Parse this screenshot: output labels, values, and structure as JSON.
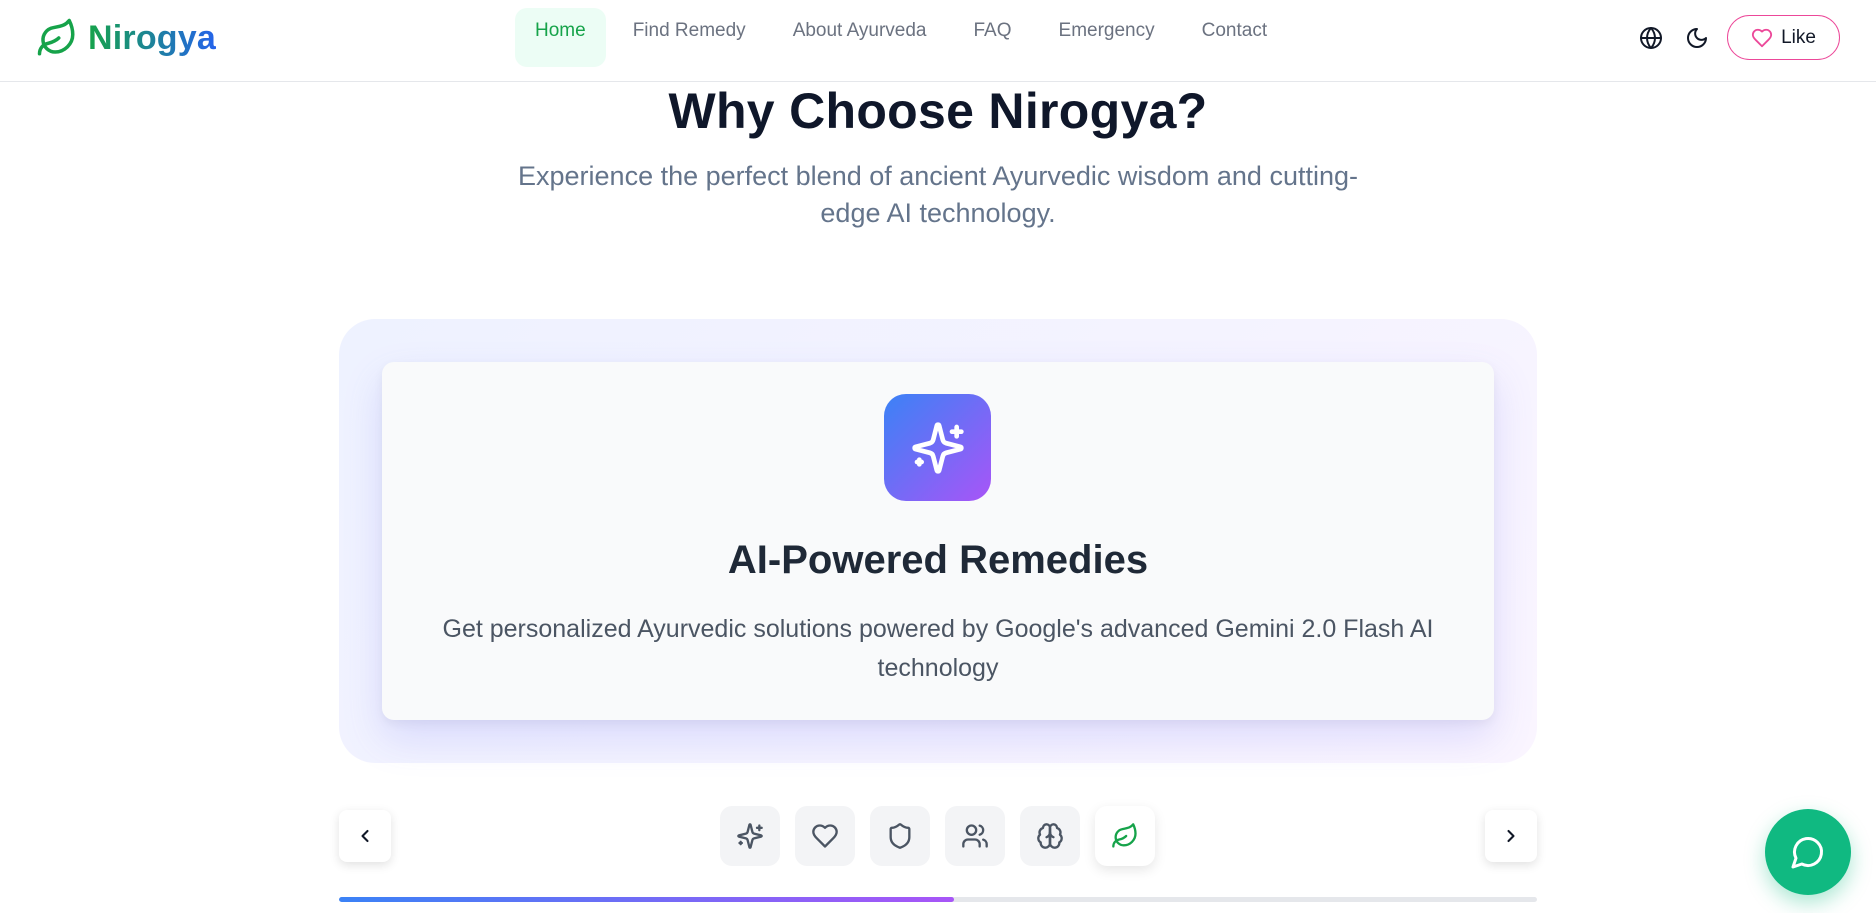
{
  "brand": {
    "name": "Nirogya",
    "icon": "leaf-icon"
  },
  "nav": {
    "items": [
      {
        "label": "Home",
        "active": true
      },
      {
        "label": "Find Remedy",
        "active": false
      },
      {
        "label": "About Ayurveda",
        "active": false
      },
      {
        "label": "FAQ",
        "active": false
      },
      {
        "label": "Emergency",
        "active": false
      },
      {
        "label": "Contact",
        "active": false
      }
    ]
  },
  "header_actions": {
    "language_icon": "globe-icon",
    "theme_icon": "moon-icon",
    "like_label": "Like",
    "like_icon": "heart-icon"
  },
  "section": {
    "title": "Why Choose Nirogya?",
    "subtitle": "Experience the perfect blend of ancient Ayurvedic wisdom and cutting-edge AI technology."
  },
  "carousel": {
    "current_card": {
      "icon": "sparkles-icon",
      "title": "AI-Powered Remedies",
      "description": "Get personalized Ayurvedic solutions powered by Google's advanced Gemini 2.0 Flash AI technology"
    },
    "indicators": [
      {
        "icon": "sparkles-icon"
      },
      {
        "icon": "heart-icon"
      },
      {
        "icon": "shield-icon"
      },
      {
        "icon": "users-icon"
      },
      {
        "icon": "brain-icon"
      },
      {
        "icon": "leaf-icon"
      }
    ],
    "active_indicator": 5,
    "progress": 0.513
  },
  "colors": {
    "brand_green": "#16a34a",
    "brand_blue": "#2563eb",
    "gradient_start": "#3b82f6",
    "gradient_end": "#a855f7",
    "like_border": "#ec4899",
    "chat_button": "#10b981"
  },
  "chat_button_icon": "message-circle-icon"
}
